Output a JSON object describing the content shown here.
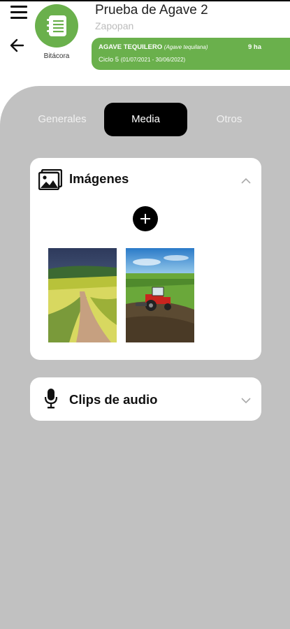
{
  "header": {
    "logo_label": "Bitácora",
    "title": "Prueba de Agave 2",
    "subtitle": "Zapopan",
    "brand_color": "#6ab04c"
  },
  "crop": {
    "name": "AGAVE TEQUILERO",
    "scientific_name": "(Agave tequilana)",
    "area": "9 ha",
    "cycle": "Ciclo 5",
    "cycle_dates": "(01/07/2021 - 30/06/2022)"
  },
  "tabs": [
    {
      "label": "Generales",
      "active": false
    },
    {
      "label": "Media",
      "active": true
    },
    {
      "label": "Otros",
      "active": false
    }
  ],
  "images_section": {
    "title": "Imágenes",
    "icon": "image-gallery-icon",
    "expanded": true,
    "thumbnails": [
      {
        "name": "image-thumbnail-field-path"
      },
      {
        "name": "image-thumbnail-tractor"
      }
    ]
  },
  "audio_section": {
    "title": "Clips de audio",
    "icon": "microphone-icon",
    "expanded": false
  }
}
